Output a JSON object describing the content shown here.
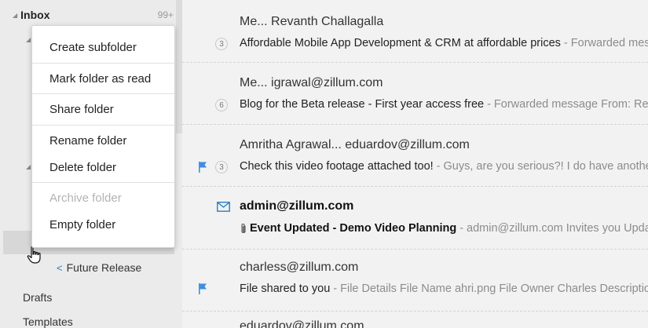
{
  "sidebar": {
    "inbox_label": "Inbox",
    "inbox_count": "99+",
    "future_release": "Future Release",
    "drafts": "Drafts",
    "templates": "Templates"
  },
  "context_menu": {
    "items": [
      {
        "label": "Create subfolder",
        "enabled": true
      },
      {
        "label": "Mark folder as read",
        "enabled": true
      },
      {
        "label": "Share folder",
        "enabled": true
      },
      {
        "label": "Rename folder",
        "enabled": true
      },
      {
        "label": "Delete folder",
        "enabled": true
      },
      {
        "label": "Archive folder",
        "enabled": false
      },
      {
        "label": "Empty folder",
        "enabled": true
      }
    ]
  },
  "mails": [
    {
      "sender": "Me... Revanth Challagalla",
      "count": "3",
      "subject": "Affordable Mobile App Development & CRM at affordable prices",
      "preview": "- Forwarded message From:",
      "flagged": false,
      "unread": false
    },
    {
      "sender": "Me... igrawal@zillum.com",
      "count": "6",
      "subject": "Blog for the Beta release - First year access free",
      "preview": "- Forwarded message From: Revanth",
      "flagged": false,
      "unread": false
    },
    {
      "sender": "Amritha Agrawal... eduardov@zillum.com",
      "count": "3",
      "subject": "Check this video footage attached too!",
      "preview": "- Guys, are you serious?! I do have another",
      "flagged": true,
      "unread": false
    },
    {
      "sender": "admin@zillum.com",
      "count": "",
      "subject": "Event Updated - Demo Video Planning",
      "preview": "- admin@zillum.com Invites you Update",
      "flagged": false,
      "unread": true,
      "attachment": true
    },
    {
      "sender": "charless@zillum.com",
      "count": "",
      "subject": "File shared to you",
      "preview": "- File Details File Name ahri.png File Owner Charles Description",
      "flagged": true,
      "unread": false
    },
    {
      "sender": "eduardov@zillum.com",
      "count": "",
      "subject": "",
      "preview": "",
      "flagged": false,
      "unread": false
    }
  ],
  "colors": {
    "accent": "#2a7cc7",
    "flag": "#3d8ee0",
    "sidebar_bg": "#ebebeb",
    "list_bg": "#f2f2f2"
  }
}
